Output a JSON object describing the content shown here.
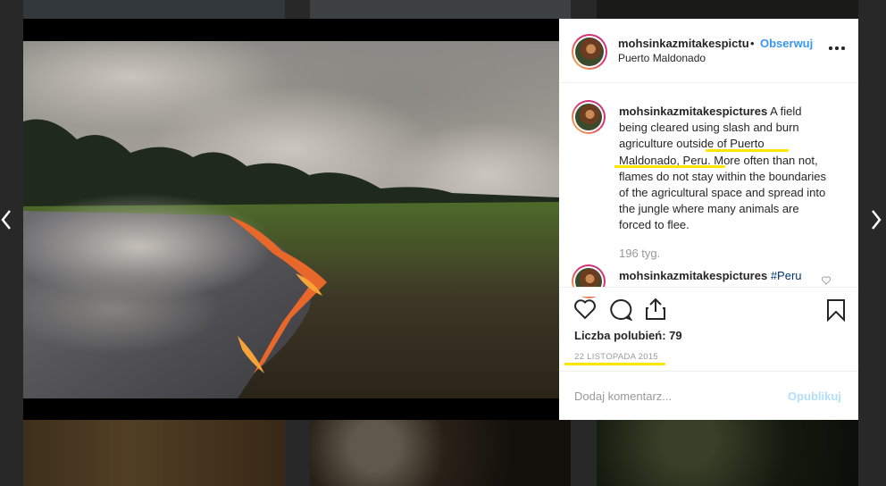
{
  "post": {
    "username": "mohsinkazmitakespictures",
    "separator": "•",
    "follow_label": "Obserwuj",
    "location": "Puerto Maldonado",
    "caption": {
      "author": "mohsinkazmitakespictures",
      "text": " A field being cleared using slash and burn agriculture outside of Puerto Maldonado, Peru. More often than not, flames do not stay within the boundaries of the agricultural space and spread into the jungle where many animals are forced to flee."
    },
    "age": "196 tyg.",
    "second_comment": {
      "author": "mohsinkazmitakespictures",
      "text": "#Peru"
    },
    "likes_text": "Liczba polubień: 79",
    "date": "22 LISTOPADA 2015",
    "comment_placeholder": "Dodaj komentarz...",
    "post_label": "Opublikuj"
  },
  "icons": {
    "more": "more-options-icon",
    "like": "heart-icon",
    "comment": "comment-icon",
    "share": "share-icon",
    "save": "bookmark-icon",
    "prev": "chevron-left-icon",
    "next": "chevron-right-icon"
  },
  "colors": {
    "link": "#3897f0",
    "highlight": "#ffe600",
    "text": "#262626",
    "muted": "#999999"
  }
}
